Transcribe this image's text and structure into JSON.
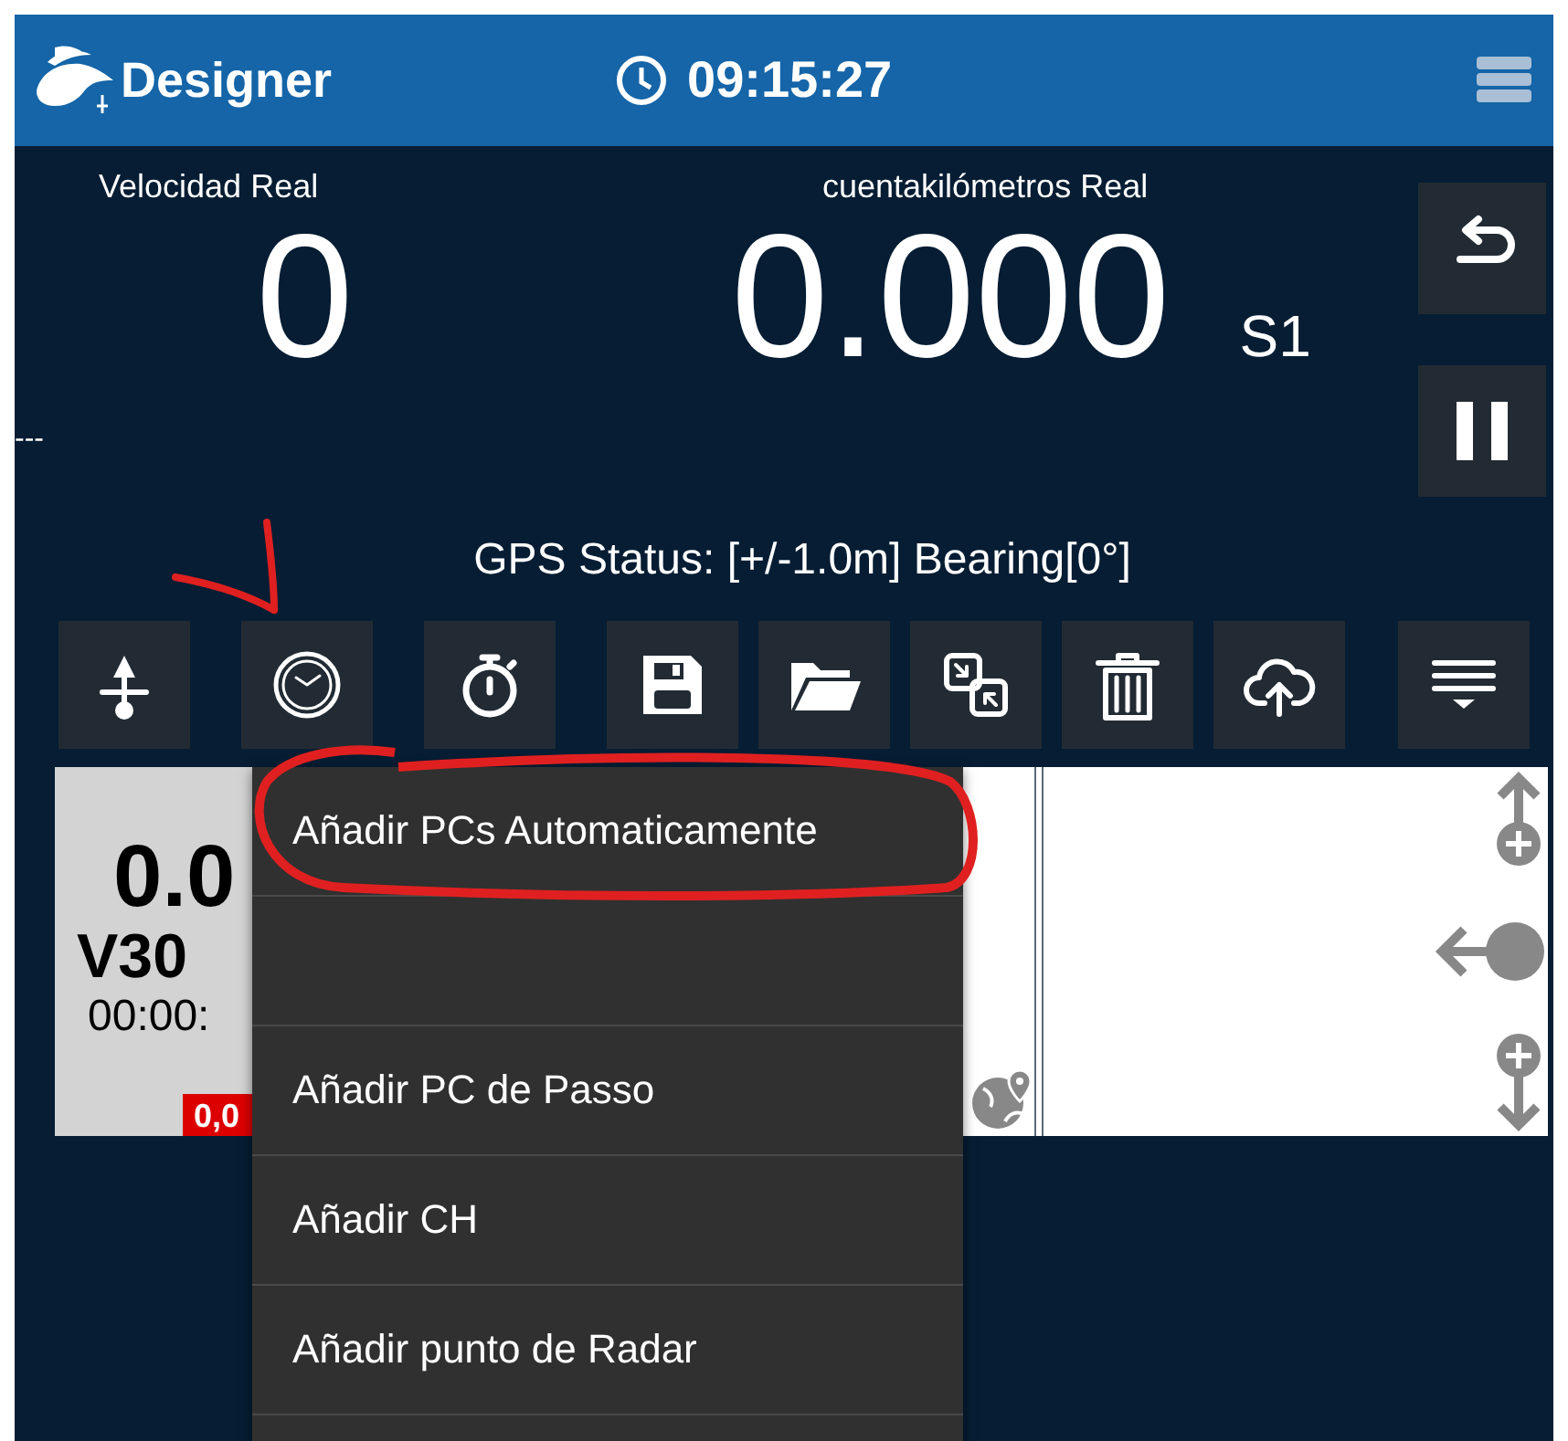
{
  "header": {
    "title": "Designer",
    "time": "09:15:27"
  },
  "readings": {
    "speed": {
      "label": "Velocidad Real",
      "value": "0"
    },
    "odometer": {
      "label": "cuentakilómetros Real",
      "value": "0.000",
      "section": "S1"
    },
    "side_text": "---"
  },
  "side_buttons": [
    {
      "kind": "undo"
    },
    {
      "kind": "pause"
    }
  ],
  "gps_status": "GPS Status: [+/-1.0m]  Bearing[0°]",
  "toolbar": [
    {
      "kind": "pin"
    },
    {
      "kind": "clock"
    },
    {
      "kind": "stopwatch"
    },
    {
      "kind": "save"
    },
    {
      "kind": "folder"
    },
    {
      "kind": "swap"
    },
    {
      "kind": "trash"
    },
    {
      "kind": "upload"
    },
    {
      "kind": "list"
    }
  ],
  "card": {
    "value": "0.0",
    "name": "V30",
    "time": "00:00:",
    "badge": "0,0"
  },
  "menu": {
    "items": [
      {
        "kind": "text",
        "label": "Añadir PCs Automaticamente"
      },
      {
        "kind": "blank"
      },
      {
        "kind": "text",
        "label": "Añadir PC de Passo"
      },
      {
        "kind": "text",
        "label": "Añadir CH"
      },
      {
        "kind": "text",
        "label": "Añadir punto de Radar"
      },
      {
        "kind": "blank"
      }
    ]
  }
}
